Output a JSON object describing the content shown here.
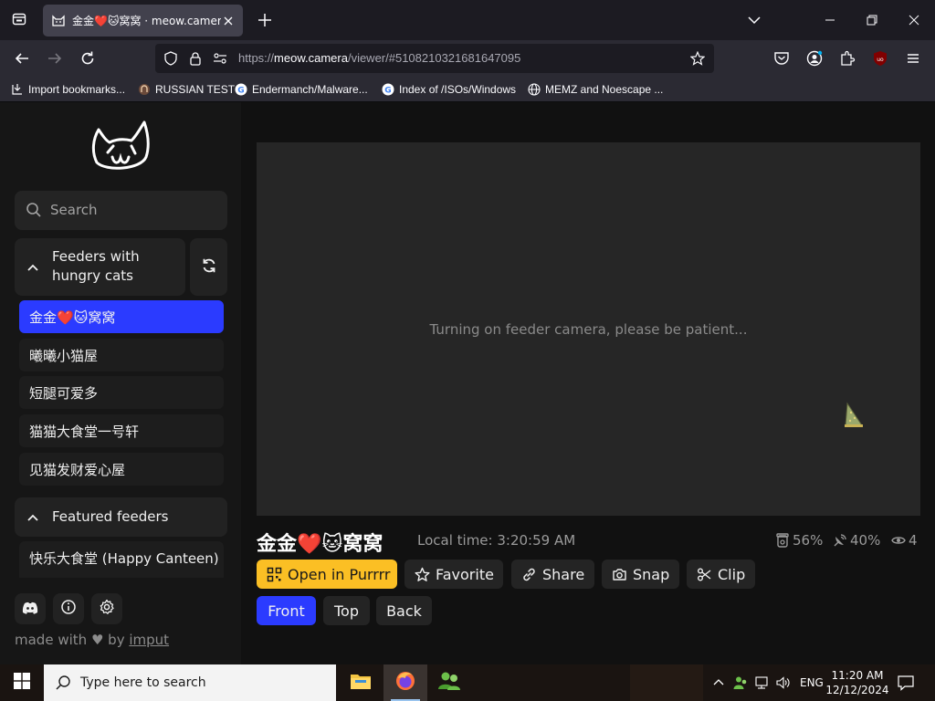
{
  "browser": {
    "tab": {
      "title": "金金❤️🐱窝窝 · meow.camera"
    },
    "url": {
      "scheme": "https://",
      "host": "meow.camera",
      "path": "/viewer/#5108210321681647095"
    },
    "bookmarks": [
      {
        "label": "Import bookmarks..."
      },
      {
        "label": "RUSSIAN TEST"
      },
      {
        "label": "Endermanch/Malware..."
      },
      {
        "label": "Index of /ISOs/Windows"
      },
      {
        "label": "MEMZ and Noescape ..."
      }
    ],
    "extension_badge": "uo"
  },
  "sidebar": {
    "search_placeholder": "Search",
    "hungry_group": {
      "title": "Feeders with hungry cats",
      "feeders": [
        {
          "label": "金金❤️🐱窝窝",
          "active": true
        },
        {
          "label": "曦曦小猫屋",
          "active": false
        },
        {
          "label": "短腿可爱多",
          "active": false
        },
        {
          "label": "猫猫大食堂一号轩",
          "active": false
        },
        {
          "label": "见猫发财爱心屋",
          "active": false
        }
      ]
    },
    "featured_group": {
      "title": "Featured feeders",
      "feeders": [
        {
          "label": "快乐大食堂 (Happy Canteen)"
        }
      ]
    },
    "footer": {
      "made_with": "made with",
      "by": "by",
      "author": "imput"
    }
  },
  "viewer": {
    "status_message": "Turning on feeder camera, please be patient...",
    "feeder_name": "金金❤️🐱窝窝",
    "local_time": "Local time: 3:20:59 AM",
    "stats": {
      "food": "56%",
      "battery": "40%",
      "viewers": "4"
    },
    "actions": {
      "open": "Open in Purrrr",
      "favorite": "Favorite",
      "share": "Share",
      "snap": "Snap",
      "clip": "Clip"
    },
    "cameras": [
      {
        "label": "Front",
        "active": true
      },
      {
        "label": "Top",
        "active": false
      },
      {
        "label": "Back",
        "active": false
      }
    ]
  },
  "taskbar": {
    "search_placeholder": "Type here to search",
    "language": "ENG",
    "time": "11:20 AM",
    "date": "12/12/2024"
  },
  "colors": {
    "accent_blue": "#2b3bff",
    "accent_yellow": "#fbbf24"
  }
}
